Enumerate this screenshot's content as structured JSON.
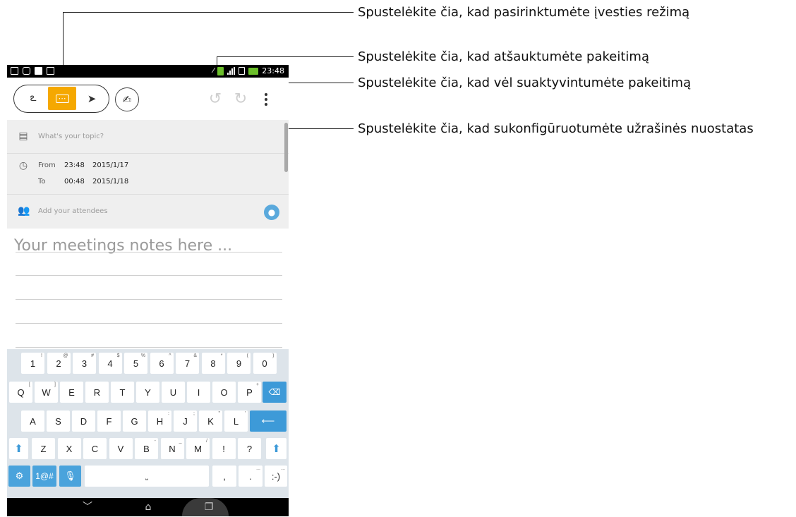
{
  "callouts": {
    "input_mode": "Spustelėkite čia, kad pasirinktumėte įvesties režimą",
    "undo": "Spustelėkite čia, kad atšauktumėte pakeitimą",
    "redo": "Spustelėkite čia, kad vėl suaktyvintumėte pakeitimą",
    "settings": "Spustelėkite čia, kad sukonfigūruotumėte užrašinės nuostatas"
  },
  "status_bar": {
    "time": "23:48"
  },
  "form": {
    "topic_placeholder": "What's your topic?",
    "from_label": "From",
    "from_time": "23:48",
    "from_date": "2015/1/17",
    "to_label": "To",
    "to_time": "00:48",
    "to_date": "2015/1/18",
    "attendees_placeholder": "Add your attendees",
    "notes_placeholder": "Your meetings notes here ..."
  },
  "keyboard": {
    "number_row": [
      {
        "k": "1",
        "s": "!"
      },
      {
        "k": "2",
        "s": "@"
      },
      {
        "k": "3",
        "s": "#"
      },
      {
        "k": "4",
        "s": "$"
      },
      {
        "k": "5",
        "s": "%"
      },
      {
        "k": "6",
        "s": "^"
      },
      {
        "k": "7",
        "s": "&"
      },
      {
        "k": "8",
        "s": "*"
      },
      {
        "k": "9",
        "s": "("
      },
      {
        "k": "0",
        "s": ")"
      }
    ],
    "row_q": [
      {
        "k": "Q",
        "s": "["
      },
      {
        "k": "W",
        "s": "]"
      },
      {
        "k": "E",
        "s": ""
      },
      {
        "k": "R",
        "s": ""
      },
      {
        "k": "T",
        "s": ""
      },
      {
        "k": "Y",
        "s": ""
      },
      {
        "k": "U",
        "s": ""
      },
      {
        "k": "I",
        "s": ""
      },
      {
        "k": "O",
        "s": ""
      },
      {
        "k": "P",
        "s": "+"
      }
    ],
    "row_a": [
      {
        "k": "A",
        "s": ""
      },
      {
        "k": "S",
        "s": ""
      },
      {
        "k": "D",
        "s": ""
      },
      {
        "k": "F",
        "s": ""
      },
      {
        "k": "G",
        "s": ""
      },
      {
        "k": "H",
        "s": ":"
      },
      {
        "k": "J",
        "s": ";"
      },
      {
        "k": "K",
        "s": "\""
      },
      {
        "k": "L",
        "s": "'"
      }
    ],
    "row_z": [
      {
        "k": "Z",
        "s": ""
      },
      {
        "k": "X",
        "s": ""
      },
      {
        "k": "C",
        "s": ""
      },
      {
        "k": "V",
        "s": ""
      },
      {
        "k": "B",
        "s": "-"
      },
      {
        "k": "N",
        "s": "_"
      },
      {
        "k": "M",
        "s": "/"
      },
      {
        "k": "!",
        "s": ""
      },
      {
        "k": "?",
        "s": ""
      }
    ],
    "symbols_label": "1@#",
    "comma": ",",
    "period": ".",
    "smiley": ":-)",
    "ellipsis": "..."
  },
  "icons": {
    "handwriting": "handwriting-icon",
    "keyboard": "keyboard-icon",
    "pen": "pen-icon",
    "draw": "draw-icon",
    "undo": "undo-icon",
    "redo": "redo-icon",
    "more": "more-vertical-icon",
    "backspace": "backspace-icon",
    "enter": "enter-icon",
    "shift": "shift-icon",
    "settings": "gear-icon",
    "mic": "microphone-icon",
    "back": "back-icon",
    "home": "home-icon",
    "recents": "recents-icon"
  },
  "colors": {
    "accent_yellow": "#f5a800",
    "key_blue": "#3d9ad8",
    "keyboard_bg": "#dde4ea"
  }
}
